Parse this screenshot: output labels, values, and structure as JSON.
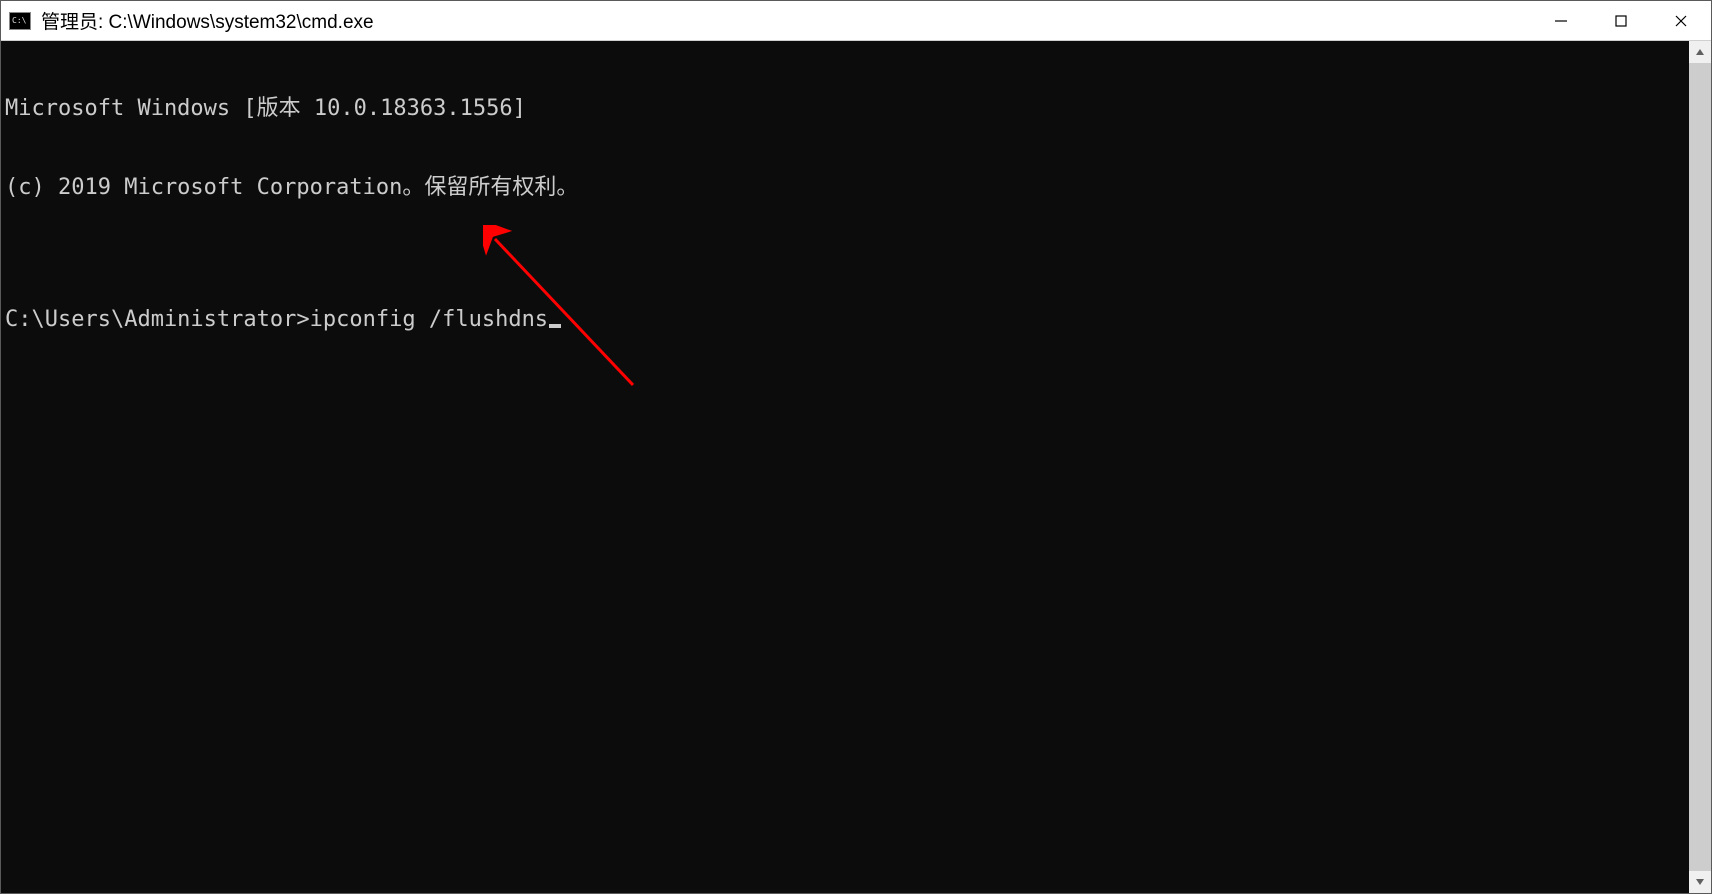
{
  "window": {
    "title": "管理员: C:\\Windows\\system32\\cmd.exe"
  },
  "terminal": {
    "line1": "Microsoft Windows [版本 10.0.18363.1556]",
    "line2": "(c) 2019 Microsoft Corporation。保留所有权利。",
    "blank": "",
    "prompt": "C:\\Users\\Administrator>",
    "command": "ipconfig /flushdns"
  },
  "annotation": {
    "arrow_color": "#ff0000"
  }
}
